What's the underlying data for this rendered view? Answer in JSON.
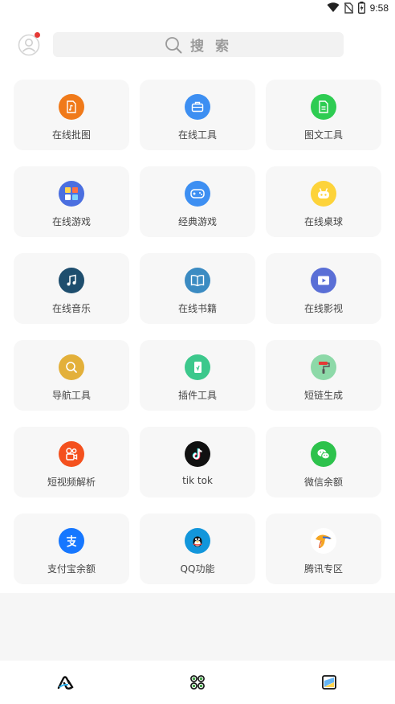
{
  "status_bar": {
    "time": "9:58"
  },
  "header": {
    "search_label": "搜 索"
  },
  "grid": {
    "items": [
      {
        "label": "在线批图",
        "icon": "image-file-icon",
        "color": "#F07A1A"
      },
      {
        "label": "在线工具",
        "icon": "briefcase-icon",
        "color": "#3D8FF2"
      },
      {
        "label": "图文工具",
        "icon": "document-icon",
        "color": "#2ECC52"
      },
      {
        "label": "在线游戏",
        "icon": "game-tiles-icon",
        "color": "#4B6FE0"
      },
      {
        "label": "经典游戏",
        "icon": "gamepad-icon",
        "color": "#3D8FF2"
      },
      {
        "label": "在线桌球",
        "icon": "robot-face-icon",
        "color": "#FDD33A"
      },
      {
        "label": "在线音乐",
        "icon": "music-note-icon",
        "color": "#1E4E6E"
      },
      {
        "label": "在线书籍",
        "icon": "open-book-icon",
        "color": "#3B8BC2"
      },
      {
        "label": "在线影视",
        "icon": "video-play-icon",
        "color": "#5A6FD6"
      },
      {
        "label": "导航工具",
        "icon": "magnifier-icon",
        "color": "#E3B03A"
      },
      {
        "label": "插件工具",
        "icon": "plugin-phone-icon",
        "color": "#3CC88C"
      },
      {
        "label": "短链生成",
        "icon": "paint-roller-icon",
        "color": "#8DD9A8"
      },
      {
        "label": "短视频解析",
        "icon": "kuaishou-icon",
        "color": "#F4511E"
      },
      {
        "label": "tik tok",
        "icon": "tiktok-icon",
        "color": "#111111"
      },
      {
        "label": "微信余额",
        "icon": "wechat-icon",
        "color": "#2DC24C"
      },
      {
        "label": "支付宝余额",
        "icon": "alipay-icon",
        "color": "#1677FF"
      },
      {
        "label": "QQ功能",
        "icon": "qq-penguin-icon",
        "color": "#1296DB"
      },
      {
        "label": "腾讯专区",
        "icon": "tencent-games-icon",
        "color": "#FFFFFF"
      }
    ]
  },
  "bottom_nav": {
    "items": [
      {
        "icon": "home-logo-icon"
      },
      {
        "icon": "apps-grid-icon"
      },
      {
        "icon": "gallery-icon"
      }
    ]
  }
}
